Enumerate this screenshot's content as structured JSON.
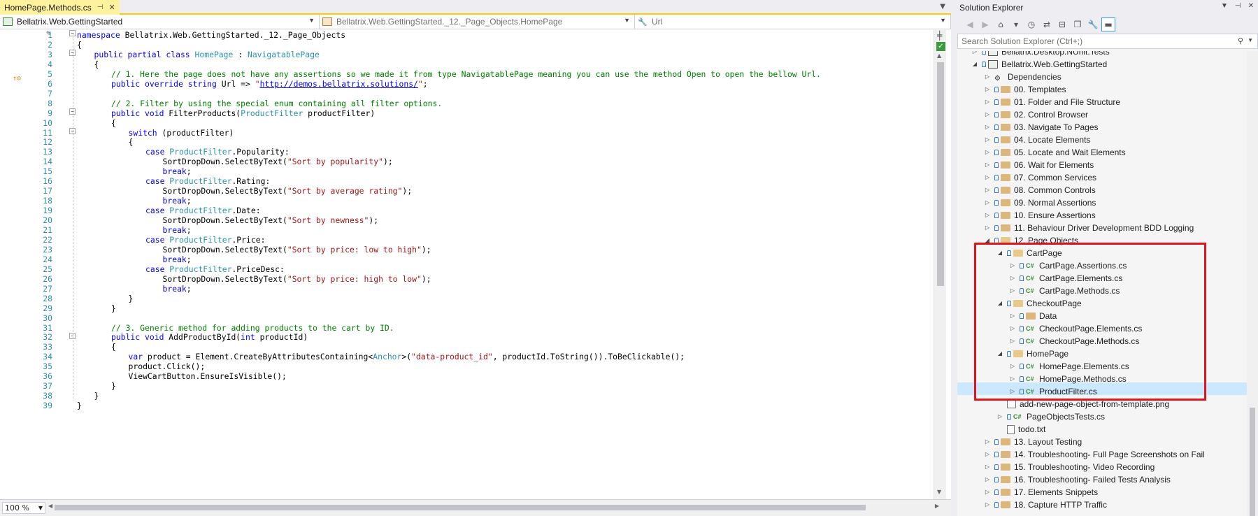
{
  "editor": {
    "tab_title": "HomePage.Methods.cs",
    "nav_project": "Bellatrix.Web.GettingStarted",
    "nav_type": "Bellatrix.Web.GettingStarted._12._Page_Objects.HomePage",
    "nav_member": "Url",
    "zoom": "100 %"
  },
  "code": {
    "line_numbers": [
      "1",
      "2",
      "3",
      "4",
      "5",
      "6",
      "7",
      "8",
      "9",
      "10",
      "11",
      "12",
      "13",
      "14",
      "15",
      "16",
      "17",
      "18",
      "19",
      "20",
      "21",
      "22",
      "23",
      "24",
      "25",
      "26",
      "27",
      "28",
      "29",
      "30",
      "31",
      "32",
      "33",
      "34",
      "35",
      "36",
      "37",
      "38",
      "39"
    ],
    "l1": [
      "namespace",
      " Bellatrix.Web.GettingStarted._12._Page_Objects"
    ],
    "l2": "{",
    "l3": [
      "public partial class",
      " ",
      "HomePage",
      " : ",
      "NavigatablePage"
    ],
    "l4": "{",
    "l5": "// 1. Here the page does not have any assertions so we made it from type NavigatablePage meaning you can use the method Open to open the bellow Url.",
    "l6": [
      "public override string",
      " Url => ",
      "\"",
      "http://demos.bellatrix.solutions/",
      "\"",
      ";"
    ],
    "l8": "// 2. Filter by using the special enum containing all filter options.",
    "l9": [
      "public void",
      " FilterProducts(",
      "ProductFilter",
      " productFilter)"
    ],
    "l10": "{",
    "l11": [
      "switch",
      " (productFilter)"
    ],
    "l12": "{",
    "l13": [
      "case",
      " ",
      "ProductFilter",
      ".Popularity:"
    ],
    "l14": [
      "SortDropDown.SelectByText(",
      "\"Sort by popularity\"",
      ");"
    ],
    "l15": [
      "break",
      ";"
    ],
    "l16": [
      "case",
      " ",
      "ProductFilter",
      ".Rating:"
    ],
    "l17": [
      "SortDropDown.SelectByText(",
      "\"Sort by average rating\"",
      ");"
    ],
    "l18": [
      "break",
      ";"
    ],
    "l19": [
      "case",
      " ",
      "ProductFilter",
      ".Date:"
    ],
    "l20": [
      "SortDropDown.SelectByText(",
      "\"Sort by newness\"",
      ");"
    ],
    "l21": [
      "break",
      ";"
    ],
    "l22": [
      "case",
      " ",
      "ProductFilter",
      ".Price:"
    ],
    "l23": [
      "SortDropDown.SelectByText(",
      "\"Sort by price: low to high\"",
      ");"
    ],
    "l24": [
      "break",
      ";"
    ],
    "l25": [
      "case",
      " ",
      "ProductFilter",
      ".PriceDesc:"
    ],
    "l26": [
      "SortDropDown.SelectByText(",
      "\"Sort by price: high to low\"",
      ");"
    ],
    "l27": [
      "break",
      ";"
    ],
    "l28": "}",
    "l29": "}",
    "l31": "// 3. Generic method for adding products to the cart by ID.",
    "l32": [
      "public void",
      " AddProductById(",
      "int",
      " productId)"
    ],
    "l33": "{",
    "l34": [
      "var",
      " product = Element.CreateByAttributesContaining<",
      "Anchor",
      ">(",
      "\"data-product_id\"",
      ", productId.ToString()).ToBeClickable();"
    ],
    "l35": "product.Click();",
    "l36": "ViewCartButton.EnsureIsVisible();",
    "l37": "}",
    "l38": "}",
    "l39": "}"
  },
  "solution_explorer": {
    "title": "Solution Explorer",
    "search_placeholder": "Search Solution Explorer (Ctrl+;)",
    "items": [
      {
        "label": "Bellatrix.Desktop.NUnit.Tests"
      },
      {
        "label": "Bellatrix.Web.GettingStarted"
      },
      {
        "label": "Dependencies"
      },
      {
        "label": "00. Templates"
      },
      {
        "label": "01. Folder and File Structure"
      },
      {
        "label": "02. Control Browser"
      },
      {
        "label": "03. Navigate To Pages"
      },
      {
        "label": "04. Locate Elements"
      },
      {
        "label": "05. Locate and Wait Elements"
      },
      {
        "label": "06. Wait for Elements"
      },
      {
        "label": "07. Common Services"
      },
      {
        "label": "08. Common Controls"
      },
      {
        "label": "09. Normal Assertions"
      },
      {
        "label": "10. Ensure Assertions"
      },
      {
        "label": "11. Behaviour Driver Development BDD Logging"
      },
      {
        "label": "12. Page Objects"
      },
      {
        "label": "CartPage"
      },
      {
        "label": "CartPage.Assertions.cs"
      },
      {
        "label": "CartPage.Elements.cs"
      },
      {
        "label": "CartPage.Methods.cs"
      },
      {
        "label": "CheckoutPage"
      },
      {
        "label": "Data"
      },
      {
        "label": "CheckoutPage.Elements.cs"
      },
      {
        "label": "CheckoutPage.Methods.cs"
      },
      {
        "label": "HomePage"
      },
      {
        "label": "HomePage.Elements.cs"
      },
      {
        "label": "HomePage.Methods.cs"
      },
      {
        "label": "ProductFilter.cs"
      },
      {
        "label": "add-new-page-object-from-template.png"
      },
      {
        "label": "PageObjectsTests.cs"
      },
      {
        "label": "todo.txt"
      },
      {
        "label": "13. Layout Testing"
      },
      {
        "label": "14. Troubleshooting- Full Page Screenshots on Fail"
      },
      {
        "label": "15. Troubleshooting- Video Recording"
      },
      {
        "label": "16. Troubleshooting- Failed Tests Analysis"
      },
      {
        "label": "17. Elements Snippets"
      },
      {
        "label": "18. Capture HTTP Traffic"
      }
    ]
  },
  "colors": {
    "tab_active": "#fff29d",
    "keyword": "#0000ff",
    "type": "#2b91af",
    "string": "#a31515",
    "comment": "#008000",
    "highlight_box": "#e0141e",
    "selection": "#cce8ff"
  }
}
